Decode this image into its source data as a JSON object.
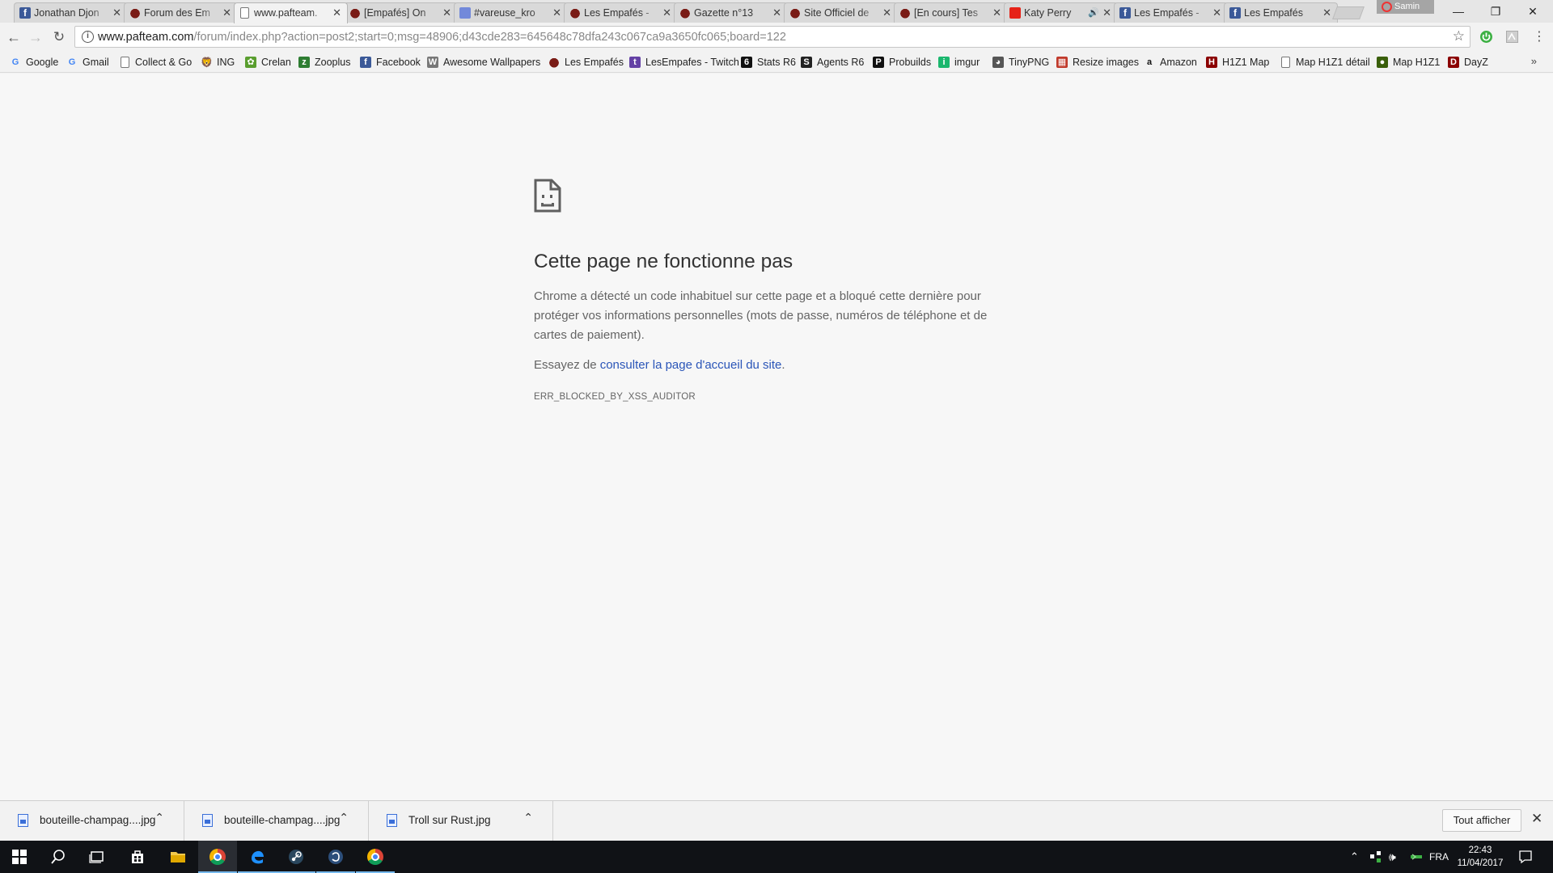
{
  "tabs": [
    {
      "title": "Jonathan Djon",
      "icon": "facebook-icon",
      "active": false
    },
    {
      "title": "Forum des Em",
      "icon": "empafes-icon",
      "active": false
    },
    {
      "title": "www.pafteam.",
      "icon": "page-icon",
      "active": true
    },
    {
      "title": "[Empafés] On",
      "icon": "empafes-icon",
      "active": false
    },
    {
      "title": "#vareuse_kro",
      "icon": "discord-icon",
      "active": false
    },
    {
      "title": "Les Empafés -",
      "icon": "empafes-icon",
      "active": false
    },
    {
      "title": "Gazette n°13",
      "icon": "empafes-icon",
      "active": false
    },
    {
      "title": "Site Officiel de",
      "icon": "empafes-icon",
      "active": false
    },
    {
      "title": "[En cours] Tes",
      "icon": "empafes-icon",
      "active": false
    },
    {
      "title": "Katy Perry",
      "icon": "youtube-icon",
      "active": false,
      "audio": true
    },
    {
      "title": "Les Empafés -",
      "icon": "facebook-icon",
      "active": false
    },
    {
      "title": "Les Empafés",
      "icon": "facebook-icon",
      "active": false
    }
  ],
  "profile": {
    "name": "Samin"
  },
  "omnibox": {
    "host": "www.pafteam.com",
    "path": "/forum/index.php?action=post2;start=0;msg=48906;d43cde283=645648c78dfa243c067ca9a3650fc065;board=122"
  },
  "bookmarks": [
    {
      "label": "Google",
      "icon": "google-icon",
      "color": "#4285f4",
      "glyph": "G"
    },
    {
      "label": "Gmail",
      "icon": "google-icon",
      "color": "#4285f4",
      "glyph": "G"
    },
    {
      "label": "Collect & Go",
      "icon": "page-icon",
      "color": "#ffffff",
      "glyph": ""
    },
    {
      "label": "ING",
      "icon": "ing-lion-icon",
      "color": "#ff6200",
      "glyph": "🦁"
    },
    {
      "label": "Crelan",
      "icon": "crelan-icon",
      "color": "#5a9e2f",
      "glyph": "✿"
    },
    {
      "label": "Zooplus",
      "icon": "zooplus-icon",
      "color": "#2e7d32",
      "glyph": "z"
    },
    {
      "label": "Facebook",
      "icon": "facebook-icon",
      "color": "#3b5998",
      "glyph": "f"
    },
    {
      "label": "Awesome Wallpapers",
      "icon": "wallpaper-icon",
      "color": "#777777",
      "glyph": "W"
    },
    {
      "label": "Les Empafés",
      "icon": "empafes-icon",
      "color": "#7a1c16",
      "glyph": ""
    },
    {
      "label": "LesEmpafes - Twitch",
      "icon": "twitch-icon",
      "color": "#6441a5",
      "glyph": "t"
    },
    {
      "label": "Stats R6",
      "icon": "r6-icon",
      "color": "#111111",
      "glyph": "6"
    },
    {
      "label": "Agents R6",
      "icon": "steam-icon",
      "color": "#222222",
      "glyph": "S"
    },
    {
      "label": "Probuilds",
      "icon": "probuilds-icon",
      "color": "#111111",
      "glyph": "P"
    },
    {
      "label": "imgur",
      "icon": "imgur-icon",
      "color": "#1bb76e",
      "glyph": "i"
    },
    {
      "label": "TinyPNG",
      "icon": "panda-icon",
      "color": "#555555",
      "glyph": "◕"
    },
    {
      "label": "Resize images",
      "icon": "grid-icon",
      "color": "#c0392b",
      "glyph": "▦"
    },
    {
      "label": "Amazon",
      "icon": "amazon-icon",
      "color": "#ffffff",
      "glyph": "a"
    },
    {
      "label": "H1Z1 Map",
      "icon": "h1z1-icon",
      "color": "#8b0000",
      "glyph": "H"
    },
    {
      "label": "Map H1Z1 détail",
      "icon": "page-icon",
      "color": "#ffffff",
      "glyph": ""
    },
    {
      "label": "Map H1Z1",
      "icon": "map-icon",
      "color": "#3a5f0b",
      "glyph": "●"
    },
    {
      "label": "DayZ",
      "icon": "dayz-icon",
      "color": "#8b0000",
      "glyph": "D"
    }
  ],
  "error": {
    "title": "Cette page ne fonctionne pas",
    "description": "Chrome a détecté un code inhabituel sur cette page et a bloqué cette dernière pour protéger vos informations personnelles (mots de passe, numéros de téléphone et de cartes de paiement).",
    "suggest_prefix": "Essayez de ",
    "suggest_link": "consulter la page d'accueil du site",
    "suggest_suffix": ".",
    "code": "ERR_BLOCKED_BY_XSS_AUDITOR"
  },
  "downloads": {
    "items": [
      {
        "name": "bouteille-champag....jpg"
      },
      {
        "name": "bouteille-champag....jpg"
      },
      {
        "name": "Troll sur Rust.jpg"
      }
    ],
    "show_all": "Tout afficher"
  },
  "taskbar": {
    "apps": [
      "windows-start-icon",
      "search-icon",
      "task-view-icon",
      "store-icon",
      "file-explorer-icon",
      "chrome-icon",
      "edge-icon",
      "steam-icon",
      "teamspeak-icon",
      "chrome-icon"
    ],
    "language": "FRA",
    "time": "22:43",
    "date": "11/04/2017"
  }
}
